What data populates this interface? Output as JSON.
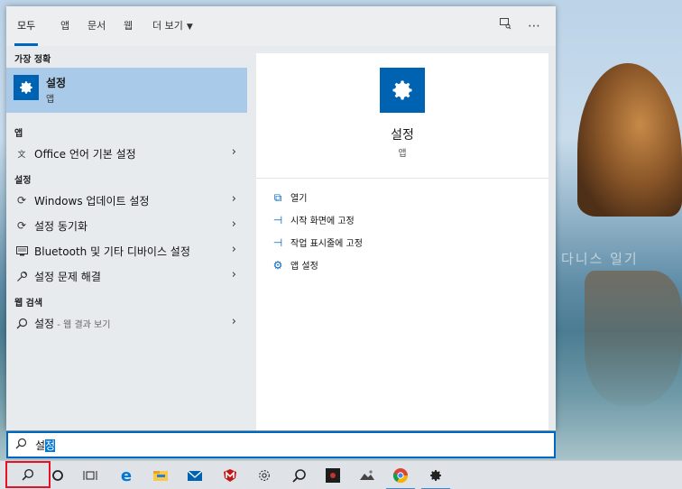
{
  "tabs": {
    "all": "모두",
    "apps": "앱",
    "documents": "문서",
    "web": "웹",
    "more": "더 보기"
  },
  "sections": {
    "best_match": "가장 정확",
    "apps": "앱",
    "settings": "설정",
    "web_search": "웹 검색"
  },
  "best_match": {
    "title": "설정",
    "subtitle": "앱"
  },
  "apps_items": [
    {
      "label": "Office 언어 기본 설정",
      "icon": "office-language-icon"
    }
  ],
  "settings_items": [
    {
      "label": "Windows 업데이트 설정",
      "icon": "refresh-icon"
    },
    {
      "label": "설정 동기화",
      "icon": "sync-icon"
    },
    {
      "label": "Bluetooth 및 기타 디바이스 설정",
      "icon": "devices-icon"
    },
    {
      "label": "설정 문제 해결",
      "icon": "wrench-icon"
    }
  ],
  "web_items": [
    {
      "label": "설정",
      "suffix": " - 웹 결과 보기",
      "icon": "search-icon"
    }
  ],
  "detail": {
    "title": "설정",
    "subtitle": "앱",
    "actions": [
      {
        "label": "열기",
        "icon": "open-icon"
      },
      {
        "label": "시작 화면에 고정",
        "icon": "pin-icon"
      },
      {
        "label": "작업 표시줄에 고정",
        "icon": "pin-icon"
      },
      {
        "label": "앱 설정",
        "icon": "gear-icon"
      }
    ]
  },
  "search": {
    "value_plain": "설",
    "value_selected": "정"
  },
  "watermark": "해피파파 다니스 일기",
  "colors": {
    "accent": "#0067c0",
    "selected_bg": "#a9cbe9",
    "app_tile": "#0063b1",
    "highlight_box": "#e81123"
  }
}
